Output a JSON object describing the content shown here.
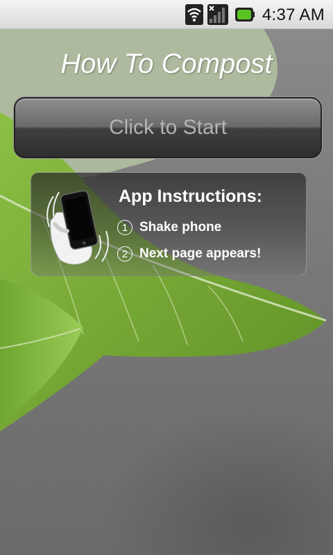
{
  "status_bar": {
    "time": "4:37 AM",
    "icons": [
      "wifi-icon",
      "signal-icon",
      "battery-icon"
    ],
    "battery_color": "#5ac223"
  },
  "screen": {
    "title": "How To Compost",
    "start_button_label": "Click to Start"
  },
  "instructions": {
    "heading": "App Instructions:",
    "steps": [
      {
        "marker": "1",
        "text": "Shake phone"
      },
      {
        "marker": "2",
        "text": "Next page appears!"
      }
    ],
    "illustration_icon": "shake-phone-icon"
  },
  "colors": {
    "leaf_green": "#7fb23a",
    "background_gray": "#7a7a7a",
    "title_text": "#ffffff"
  }
}
